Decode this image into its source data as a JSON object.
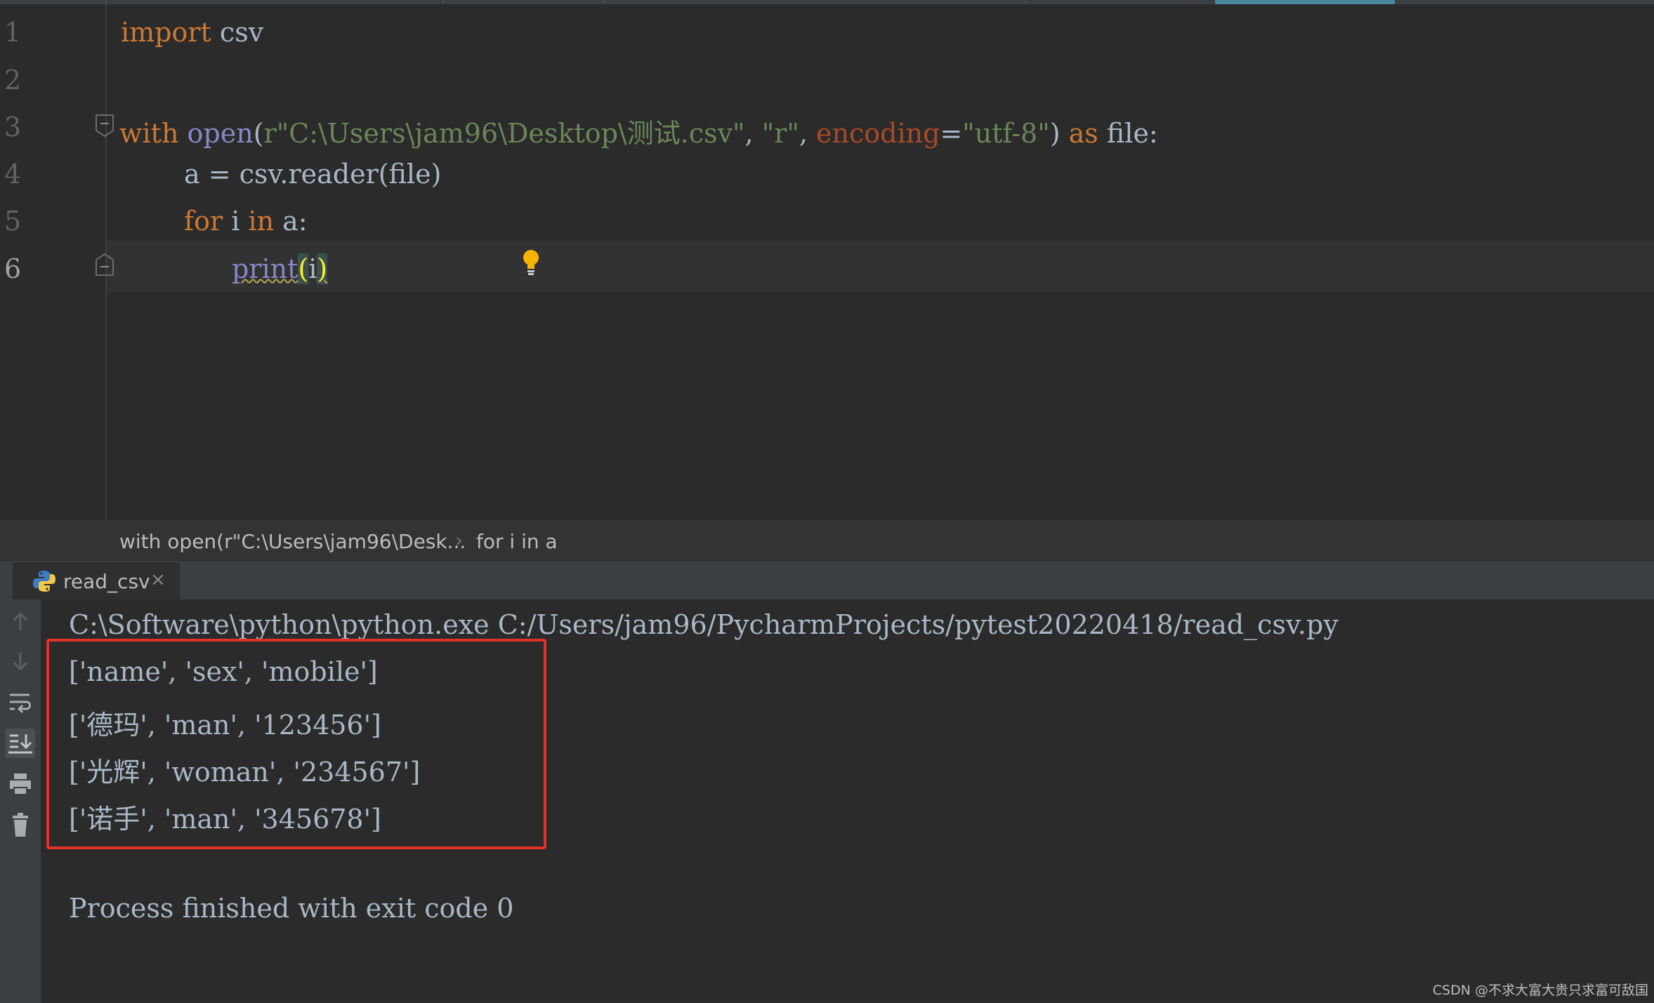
{
  "editor": {
    "line_numbers": [
      "1",
      "2",
      "3",
      "4",
      "5",
      "6"
    ],
    "line1": {
      "kw_import": "import",
      "module": " csv"
    },
    "line3": {
      "kw_with": "with",
      "sp1": " ",
      "fn_open": "open",
      "paren_open": "(",
      "path_str": "r\"C:\\Users\\jam96\\Desktop\\测试.csv\"",
      "comma1": ", ",
      "mode_str": "\"r\"",
      "comma2": ", ",
      "param_encoding": "encoding",
      "eq": "=",
      "enc_str": "\"utf-8\"",
      "paren_close": ") ",
      "kw_as": "as",
      "tail": " file:"
    },
    "line4": {
      "text": "a = csv.reader(file)"
    },
    "line5": {
      "kw_for": "for",
      "mid": " i ",
      "kw_in": "in",
      "tail": " a:"
    },
    "line6": {
      "fn_print": "print",
      "lparen": "(",
      "arg": "i",
      "rparen": ")"
    }
  },
  "breadcrumb": {
    "item1": "with open(r\"C:\\Users\\jam96\\Desk...",
    "separator": "›",
    "item2": "for i in a"
  },
  "run_tab": {
    "label": "read_csv",
    "close": "×"
  },
  "console": {
    "command": "C:\\Software\\python\\python.exe C:/Users/jam96/PycharmProjects/pytest20220418/read_csv.py",
    "rows": [
      "['name', 'sex', 'mobile']",
      "['德玛', 'man', '123456']",
      "['光辉', 'woman', '234567']",
      "['诺手', 'man', '345678']"
    ],
    "exit_message": "Process finished with exit code 0"
  },
  "watermark": "CSDN @不求大富大贵只求富可敌国",
  "icons": [
    "fold-icon",
    "intention-bulb-icon",
    "python-icon",
    "up-arrow-icon",
    "down-arrow-icon",
    "soft-wrap-icon",
    "scroll-to-end-icon",
    "print-icon",
    "trash-icon"
  ],
  "colors": {
    "background": "#2b2b2b",
    "keyword": "#cc7832",
    "string": "#6a8759",
    "builtin": "#8888c6",
    "parameter": "#aa4926",
    "highlight_box": "#e3302a"
  }
}
